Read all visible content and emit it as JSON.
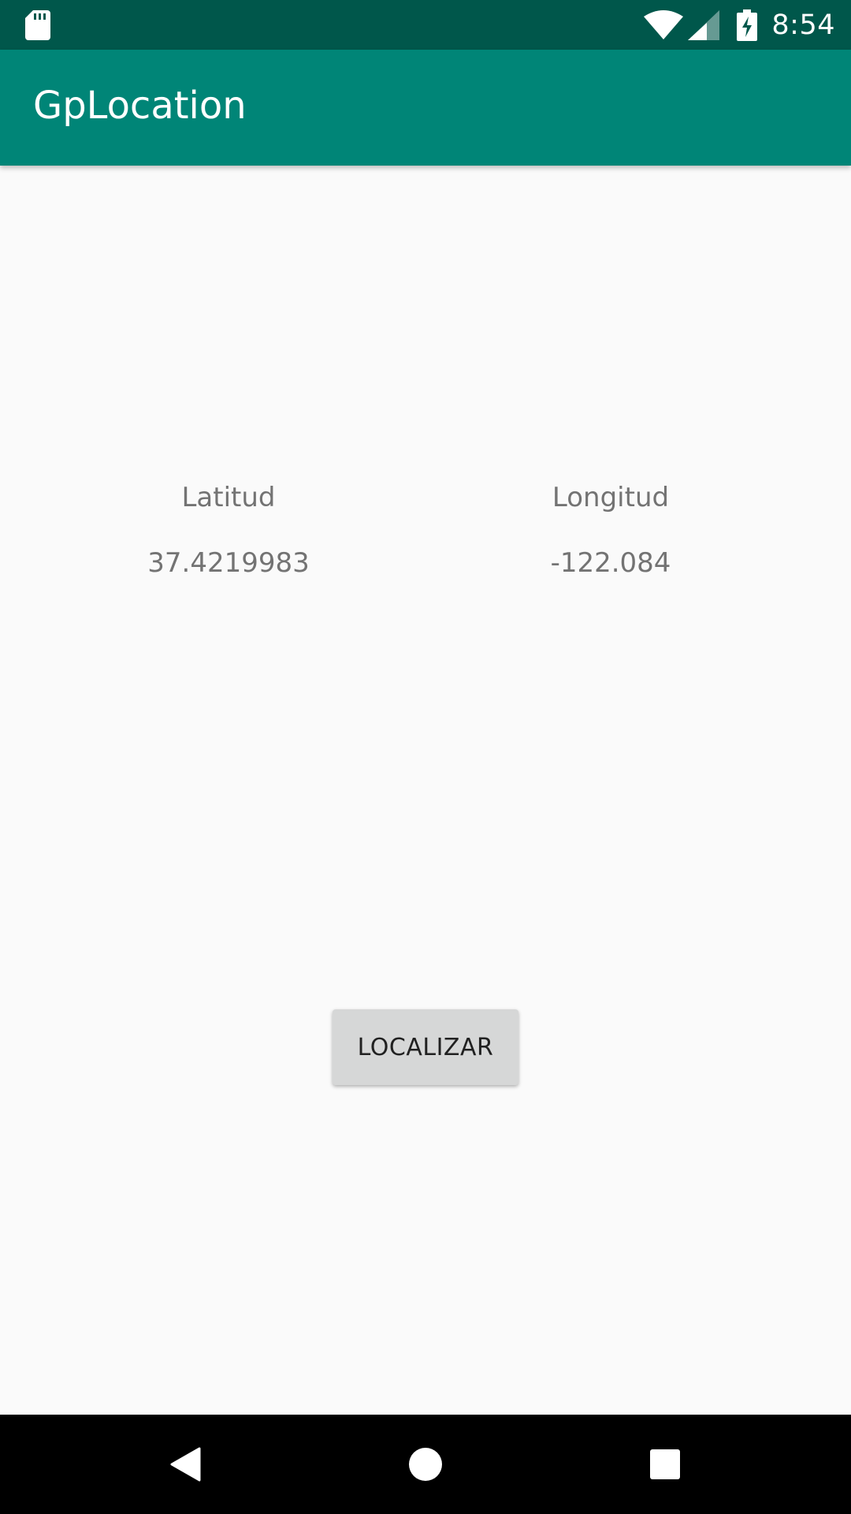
{
  "status_bar": {
    "time": "8:54",
    "icons": [
      "sd-card-icon",
      "wifi-icon",
      "signal-icon",
      "battery-charging-icon"
    ]
  },
  "app_bar": {
    "title": "GpLocation"
  },
  "location": {
    "latitude_label": "Latitud",
    "longitude_label": "Longitud",
    "latitude_value": "37.4219983",
    "longitude_value": "-122.084"
  },
  "actions": {
    "locate_label": "LOCALIZAR"
  },
  "nav_bar": {
    "icons": [
      "back-icon",
      "home-icon",
      "recents-icon"
    ]
  },
  "colors": {
    "status_bar": "#00574b",
    "app_bar": "#008577",
    "background": "#fafafa",
    "button": "#d6d7d7",
    "secondary_text": "#737373"
  }
}
